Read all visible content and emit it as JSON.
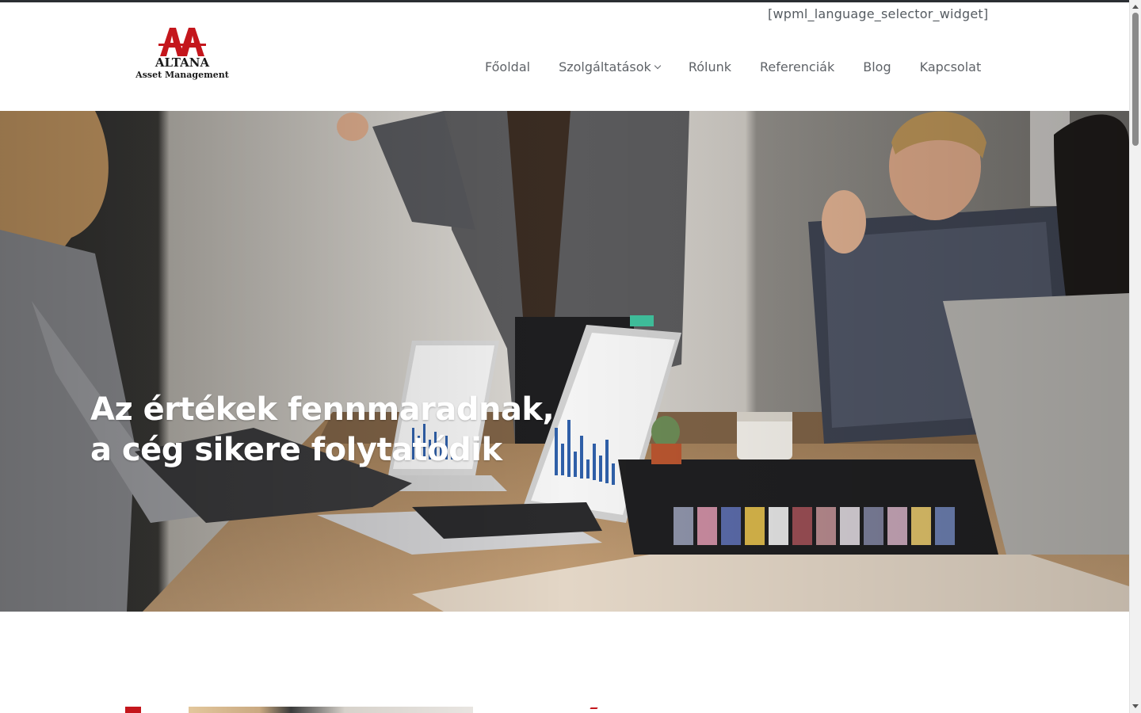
{
  "header": {
    "language_widget": "[wpml_language_selector_widget]",
    "logo": {
      "monogram": "AA",
      "name": "ALTANA",
      "subtitle": "Asset Management"
    },
    "nav": [
      {
        "label": "Főoldal"
      },
      {
        "label": "Szolgáltatások",
        "has_dropdown": true
      },
      {
        "label": "Rólunk"
      },
      {
        "label": "Referenciák"
      },
      {
        "label": "Blog"
      },
      {
        "label": "Kapcsolat"
      }
    ]
  },
  "hero": {
    "title_line1": "Az értékek fennmaradnak,",
    "title_line2": "a cég sikere folytatódik",
    "image_description_icon": "team-meeting-photo"
  },
  "colors": {
    "brand_red": "#c4161c",
    "nav_text": "#5f6368",
    "hero_text": "#ffffff"
  }
}
